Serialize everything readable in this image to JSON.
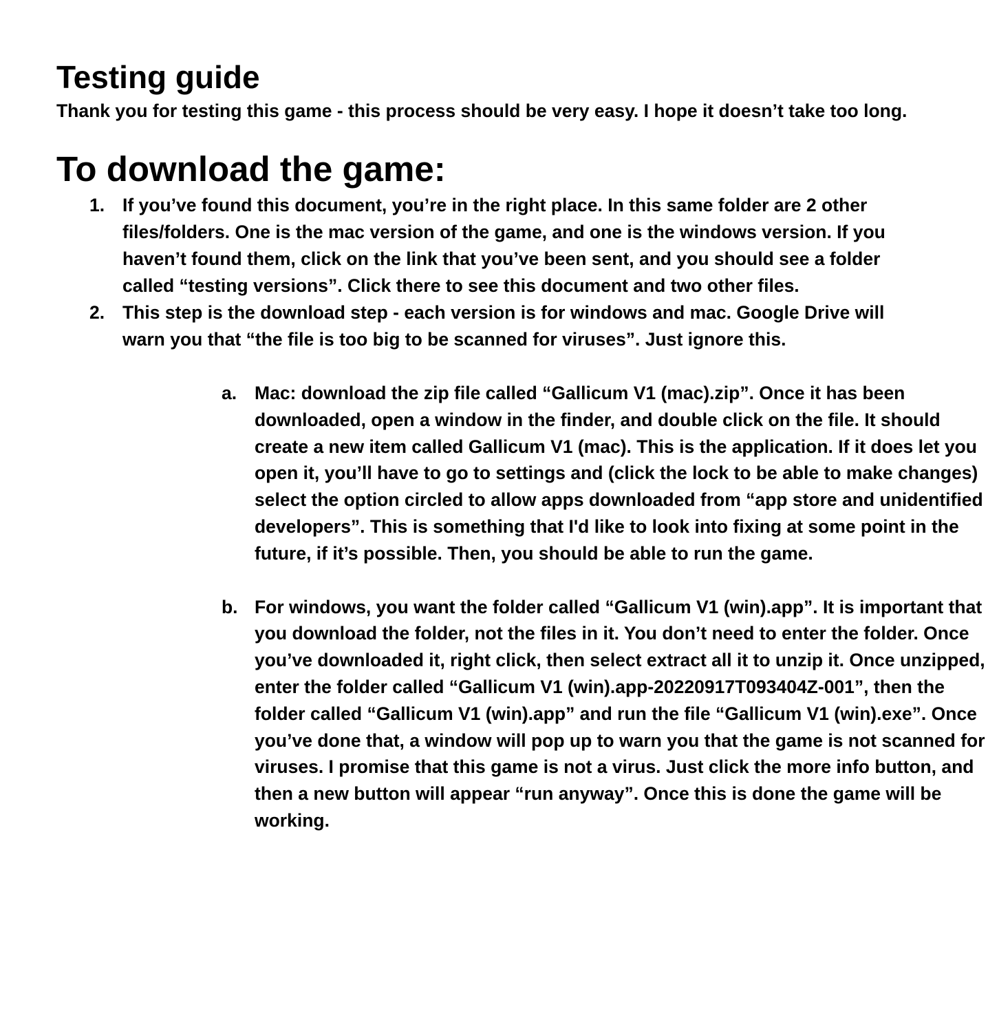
{
  "document": {
    "title": "Testing guide",
    "intro": "Thank you for testing this game - this process should be very easy. I hope it doesn’t take too long.",
    "section_heading": "To download the game:",
    "steps": [
      {
        "marker": "1.",
        "text": "If you’ve found this document, you’re in the right place. In this same folder are 2 other files/folders. One is the mac version of the game, and one is the windows version. If you haven’t found them, click on the link that you’ve been sent, and you should see a folder called “testing versions”. Click there to see this document and two other files."
      },
      {
        "marker": "2.",
        "text": "This step is the download step - each version is for windows and mac. Google Drive will warn you that “the file is too big to be scanned for viruses”. Just ignore this."
      }
    ],
    "substeps": [
      {
        "marker": "a.",
        "text": "Mac: download the zip file called “Gallicum V1 (mac).zip”. Once it has been downloaded, open a window in the finder, and double click on the file. It should create a new item called Gallicum V1 (mac). This is the application. If it does let you open it, you’ll have to go to settings and (click the lock to be able to make changes) select the option circled to allow apps downloaded from “app store and unidentified developers”. This is something that I'd like to look into fixing at some point in the future, if it’s possible. Then, you should be able to run the game."
      },
      {
        "marker": "b.",
        "text": "For windows, you want the folder called “Gallicum V1 (win).app”. It is important that you download the folder, not the files in it. You don’t need to enter the folder. Once you’ve downloaded it, right click, then select extract all it to unzip it. Once unzipped, enter the folder called “Gallicum V1 (win).app-20220917T093404Z-001”, then the folder called “Gallicum V1 (win).app” and run the file “Gallicum V1 (win).exe”. Once you’ve done that, a window will pop up to warn you that the game is not scanned for viruses. I promise that this game is not a virus. Just click the more info button, and then a new button will appear “run anyway”. Once this is done the game will be working."
      }
    ]
  }
}
